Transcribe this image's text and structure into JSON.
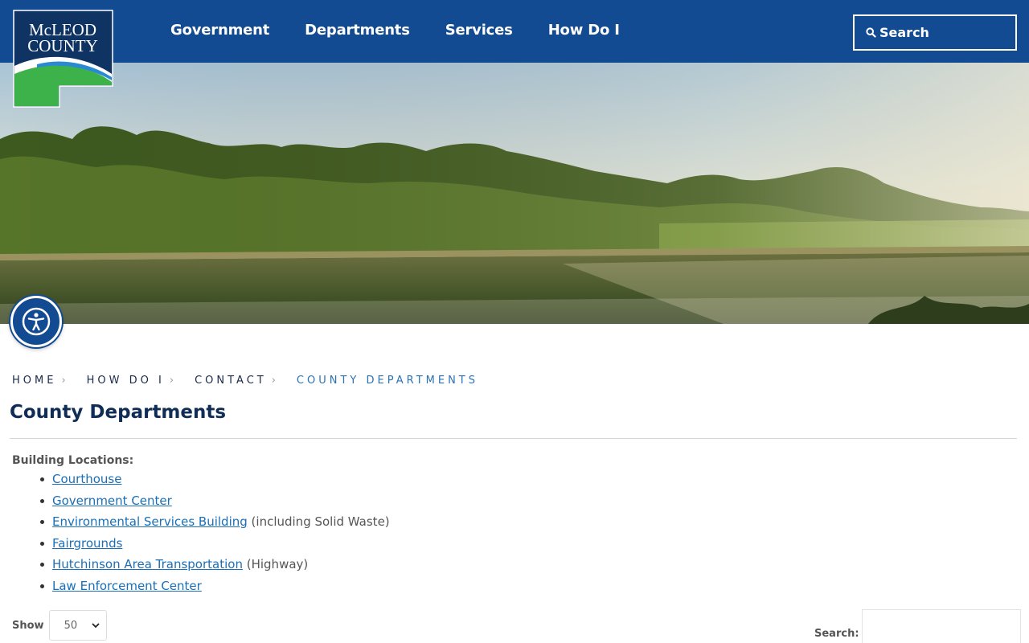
{
  "logo": {
    "line1": "McLEOD",
    "line2": "COUNTY",
    "colors": {
      "navy": "#0f3463",
      "green": "#3db24a",
      "blue": "#2a8ad1"
    }
  },
  "nav": {
    "items": [
      {
        "label": "Government"
      },
      {
        "label": "Departments"
      },
      {
        "label": "Services"
      },
      {
        "label": "How Do I"
      }
    ]
  },
  "header_search": {
    "label": "Search",
    "icon": "search-icon"
  },
  "accessibility": {
    "icon": "accessibility-person-icon"
  },
  "breadcrumb": [
    {
      "label": "Home"
    },
    {
      "label": "How Do I"
    },
    {
      "label": "Contact"
    },
    {
      "label": "County Departments"
    }
  ],
  "page": {
    "title": "County Departments",
    "section_label": "Building Locations:",
    "locations": [
      {
        "link": "Courthouse",
        "note": ""
      },
      {
        "link": "Government Center",
        "note": ""
      },
      {
        "link": "Environmental Services Building",
        "note": " (including Solid Waste)"
      },
      {
        "link": "Fairgrounds",
        "note": ""
      },
      {
        "link": "Hutchinson Area Transportation",
        "note": " (Highway)"
      },
      {
        "link": "Law Enforcement Center",
        "note": ""
      }
    ]
  },
  "table_controls": {
    "show_label": "Show",
    "show_value": "50",
    "search_label": "Search:",
    "search_value": ""
  },
  "colors": {
    "header_bg": "#134b93",
    "title": "#0f2d57",
    "link": "#1a6fb7",
    "crumb_current": "#2a72b8"
  }
}
